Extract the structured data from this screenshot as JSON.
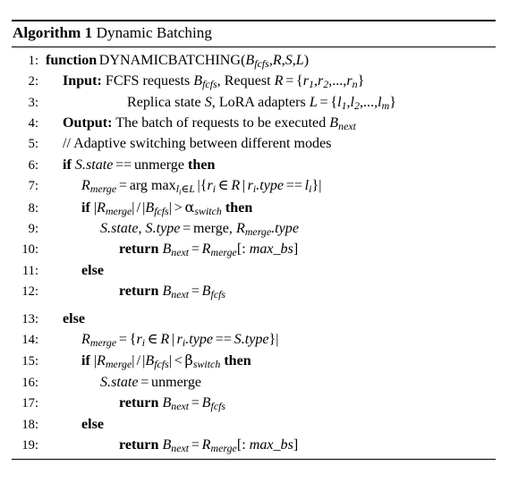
{
  "algorithm": {
    "label": "Algorithm 1",
    "title": "Dynamic Batching",
    "lines": [
      {
        "no": "1:",
        "text": "function DYNAMICBATCHING(B_fcfs, R, S, L)"
      },
      {
        "no": "2:",
        "text": "Input: FCFS requests B_fcfs, Request R = {r1, r2, ..., rn}"
      },
      {
        "no": "3:",
        "text": "Replica state S, LoRA adapters L = {l1, l2, ..., lm}"
      },
      {
        "no": "4:",
        "text": "Output: The batch of requests to be executed B_next"
      },
      {
        "no": "5:",
        "text": "// Adaptive switching between different modes"
      },
      {
        "no": "6:",
        "text": "if S.state == unmerge then"
      },
      {
        "no": "7:",
        "text": "R_merge = arg max_{l_i in L} |{r_i in R | r_i.type == l_i}|"
      },
      {
        "no": "8:",
        "text": "if |R_merge|/|B_fcfs| > alpha_switch then"
      },
      {
        "no": "9:",
        "text": "S.state, S.type = merge, R_merge.type"
      },
      {
        "no": "10:",
        "text": "return B_next = R_merge[: max_bs]"
      },
      {
        "no": "11:",
        "text": "else"
      },
      {
        "no": "12:",
        "text": "return B_next = B_fcfs"
      },
      {
        "no": "13:",
        "text": "else"
      },
      {
        "no": "14:",
        "text": "R_merge = {r_i in R | r_i.type == S.type}|"
      },
      {
        "no": "15:",
        "text": "if |R_merge|/|B_fcfs| < beta_switch then"
      },
      {
        "no": "16:",
        "text": "S.state = unmerge"
      },
      {
        "no": "17:",
        "text": "return B_next = B_fcfs"
      },
      {
        "no": "18:",
        "text": "else"
      },
      {
        "no": "19:",
        "text": "return B_next = R_merge[: max_bs]"
      }
    ],
    "keywords": {
      "function": "function",
      "input": "Input:",
      "output": "Output:",
      "if": "if",
      "then": "then",
      "else": "else",
      "return": "return"
    },
    "identifiers": {
      "proc_name": "DYNAMICBATCHING",
      "b_fcfs": "B",
      "b_fcfs_sub": "fcfs",
      "b_next": "B",
      "b_next_sub": "next",
      "r_merge": "R",
      "r_merge_sub": "merge",
      "R": "R",
      "S": "S",
      "L": "L",
      "max_bs": "max_bs",
      "merge": "merge",
      "unmerge": "unmerge",
      "alpha": "α",
      "beta": "β",
      "switch": "switch",
      "state": "state",
      "type": "type",
      "argmax": "arg max",
      "comment5": "// Adaptive switching between different modes",
      "input_text": "FCFS requests",
      "request_text": "Request",
      "replica_text": "Replica state",
      "lora_text": "LoRA adapters",
      "output_text": "The batch of requests to be executed"
    },
    "symbols": {
      "eq": "=",
      "eqeq": "==",
      "gt": ">",
      "lt": "<",
      "in": "∈",
      "mid": "|",
      "slash": "/",
      "lbrace": "{",
      "rbrace": "}",
      "lbrack": "[",
      "rbrack": "]",
      "colon": ":",
      "comma": ",",
      "dot": ".",
      "ellipsis": "...",
      "lparen": "(",
      "rparen": ")"
    },
    "colors": {
      "text": "#000000",
      "rule": "#000000",
      "background": "#ffffff"
    }
  }
}
